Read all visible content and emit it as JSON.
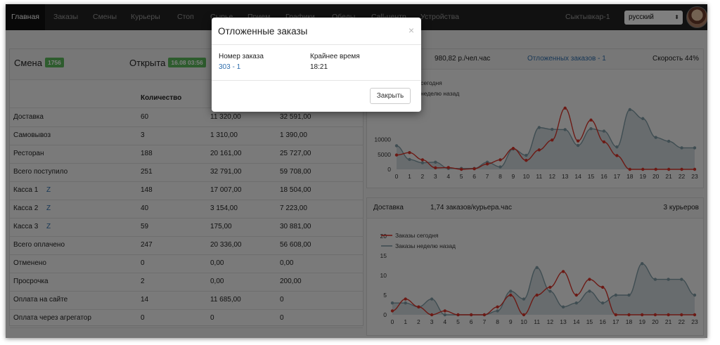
{
  "nav": {
    "items": [
      "Главная",
      "Заказы",
      "Смены",
      "Курьеры",
      "Стоп",
      "Сырье",
      "Прием",
      "Графики",
      "Обеды",
      "Call-центр",
      "Устройства"
    ],
    "city": "Сыктывкар-1",
    "language": "русский"
  },
  "shift": {
    "title": "Смена",
    "number": "1756",
    "opened_label": "Открыта",
    "opened_time": "16.08 03:56"
  },
  "table": {
    "headers": [
      "Количество"
    ],
    "rows": [
      {
        "label": "Доставка",
        "z": "",
        "qty": "60",
        "sum": "11 320,00",
        "week": "32 591,00"
      },
      {
        "label": "Самовывоз",
        "z": "",
        "qty": "3",
        "sum": "1 310,00",
        "week": "1 390,00"
      },
      {
        "label": "Ресторан",
        "z": "",
        "qty": "188",
        "sum": "20 161,00",
        "week": "25 727,00"
      },
      {
        "label": "Всего поступило",
        "z": "",
        "qty": "251",
        "sum": "32 791,00",
        "week": "59 708,00"
      },
      {
        "label": "Касса 1",
        "z": "Z",
        "qty": "148",
        "sum": "17 007,00",
        "week": "18 504,00"
      },
      {
        "label": "Касса 2",
        "z": "Z",
        "qty": "40",
        "sum": "3 154,00",
        "week": "7 223,00"
      },
      {
        "label": "Касса 3",
        "z": "Z",
        "qty": "59",
        "sum": "175,00",
        "week": "30 881,00"
      },
      {
        "label": "Всего оплачено",
        "z": "",
        "qty": "247",
        "sum": "20 336,00",
        "week": "56 608,00"
      },
      {
        "label": "Отменено",
        "z": "",
        "qty": "0",
        "sum": "0,00",
        "week": "0,00"
      },
      {
        "label": "Просрочка",
        "z": "",
        "qty": "2",
        "sum": "0,00",
        "week": "200,00"
      },
      {
        "label": "Оплата на сайте",
        "z": "",
        "qty": "14",
        "sum": "11 685,00",
        "week": "0"
      },
      {
        "label": "Оплата через агрегатор",
        "z": "",
        "qty": "0",
        "sum": "0",
        "week": "0"
      }
    ]
  },
  "revenue_panel": {
    "per_hour": "980,82 р./чел.час",
    "postponed_link": "Отложенных заказов - 1",
    "speed": "Скорость 44%"
  },
  "delivery_panel": {
    "title": "Доставка",
    "rate": "1,74 заказов/курьера.час",
    "couriers": "3 курьеров"
  },
  "modal": {
    "title": "Отложенные заказы",
    "close_icon": "×",
    "col1_header": "Номер заказа",
    "col2_header": "Крайнее время",
    "order_number": "303 - 1",
    "deadline": "18:21",
    "close_button": "Закрыть"
  },
  "colors": {
    "today": "#d9352b",
    "week_ago": "#7f9aa4",
    "badge": "#5cb85c",
    "link": "#2f6ead"
  },
  "chart_data": [
    {
      "type": "line",
      "x": [
        0,
        1,
        2,
        3,
        4,
        5,
        6,
        7,
        8,
        9,
        10,
        11,
        12,
        13,
        14,
        15,
        16,
        17,
        18,
        19,
        20,
        21,
        22,
        23
      ],
      "ylim": [
        0,
        20000
      ],
      "yticks": [
        0,
        5000,
        10000
      ],
      "series": [
        {
          "name": "Выручка сегодня",
          "color": "#d9352b",
          "values": [
            4800,
            5600,
            3200,
            500,
            600,
            0,
            200,
            1800,
            3200,
            7000,
            3000,
            6500,
            9800,
            20500,
            9500,
            16500,
            9200,
            4600,
            0,
            0,
            0,
            0,
            0,
            0
          ]
        },
        {
          "name": "Выручка неделю назад",
          "color": "#7f9aa4",
          "values": [
            7900,
            3300,
            2200,
            2400,
            300,
            300,
            300,
            2400,
            800,
            6800,
            4700,
            14000,
            13400,
            13300,
            8000,
            13600,
            12800,
            7500,
            20000,
            17000,
            10700,
            9400,
            7200,
            7200
          ]
        }
      ]
    },
    {
      "type": "line",
      "x": [
        0,
        1,
        2,
        3,
        4,
        5,
        6,
        7,
        8,
        9,
        10,
        11,
        12,
        13,
        14,
        15,
        16,
        17,
        18,
        19,
        20,
        21,
        22,
        23
      ],
      "ylim": [
        0,
        20
      ],
      "yticks": [
        0,
        5,
        10,
        15,
        20
      ],
      "series": [
        {
          "name": "Заказы сегодня",
          "color": "#d9352b",
          "values": [
            1,
            4,
            2,
            0,
            1,
            0,
            0,
            0,
            2,
            5,
            0,
            5,
            7,
            11,
            5,
            9,
            7,
            0,
            0,
            0,
            0,
            0,
            0,
            0
          ]
        },
        {
          "name": "Заказы неделю назад",
          "color": "#7f9aa4",
          "values": [
            3,
            3,
            2,
            4,
            0,
            0,
            0,
            0,
            1,
            6,
            4,
            12,
            6,
            2,
            3,
            6,
            3,
            5,
            5,
            13,
            9,
            9,
            9,
            5
          ]
        }
      ]
    }
  ]
}
